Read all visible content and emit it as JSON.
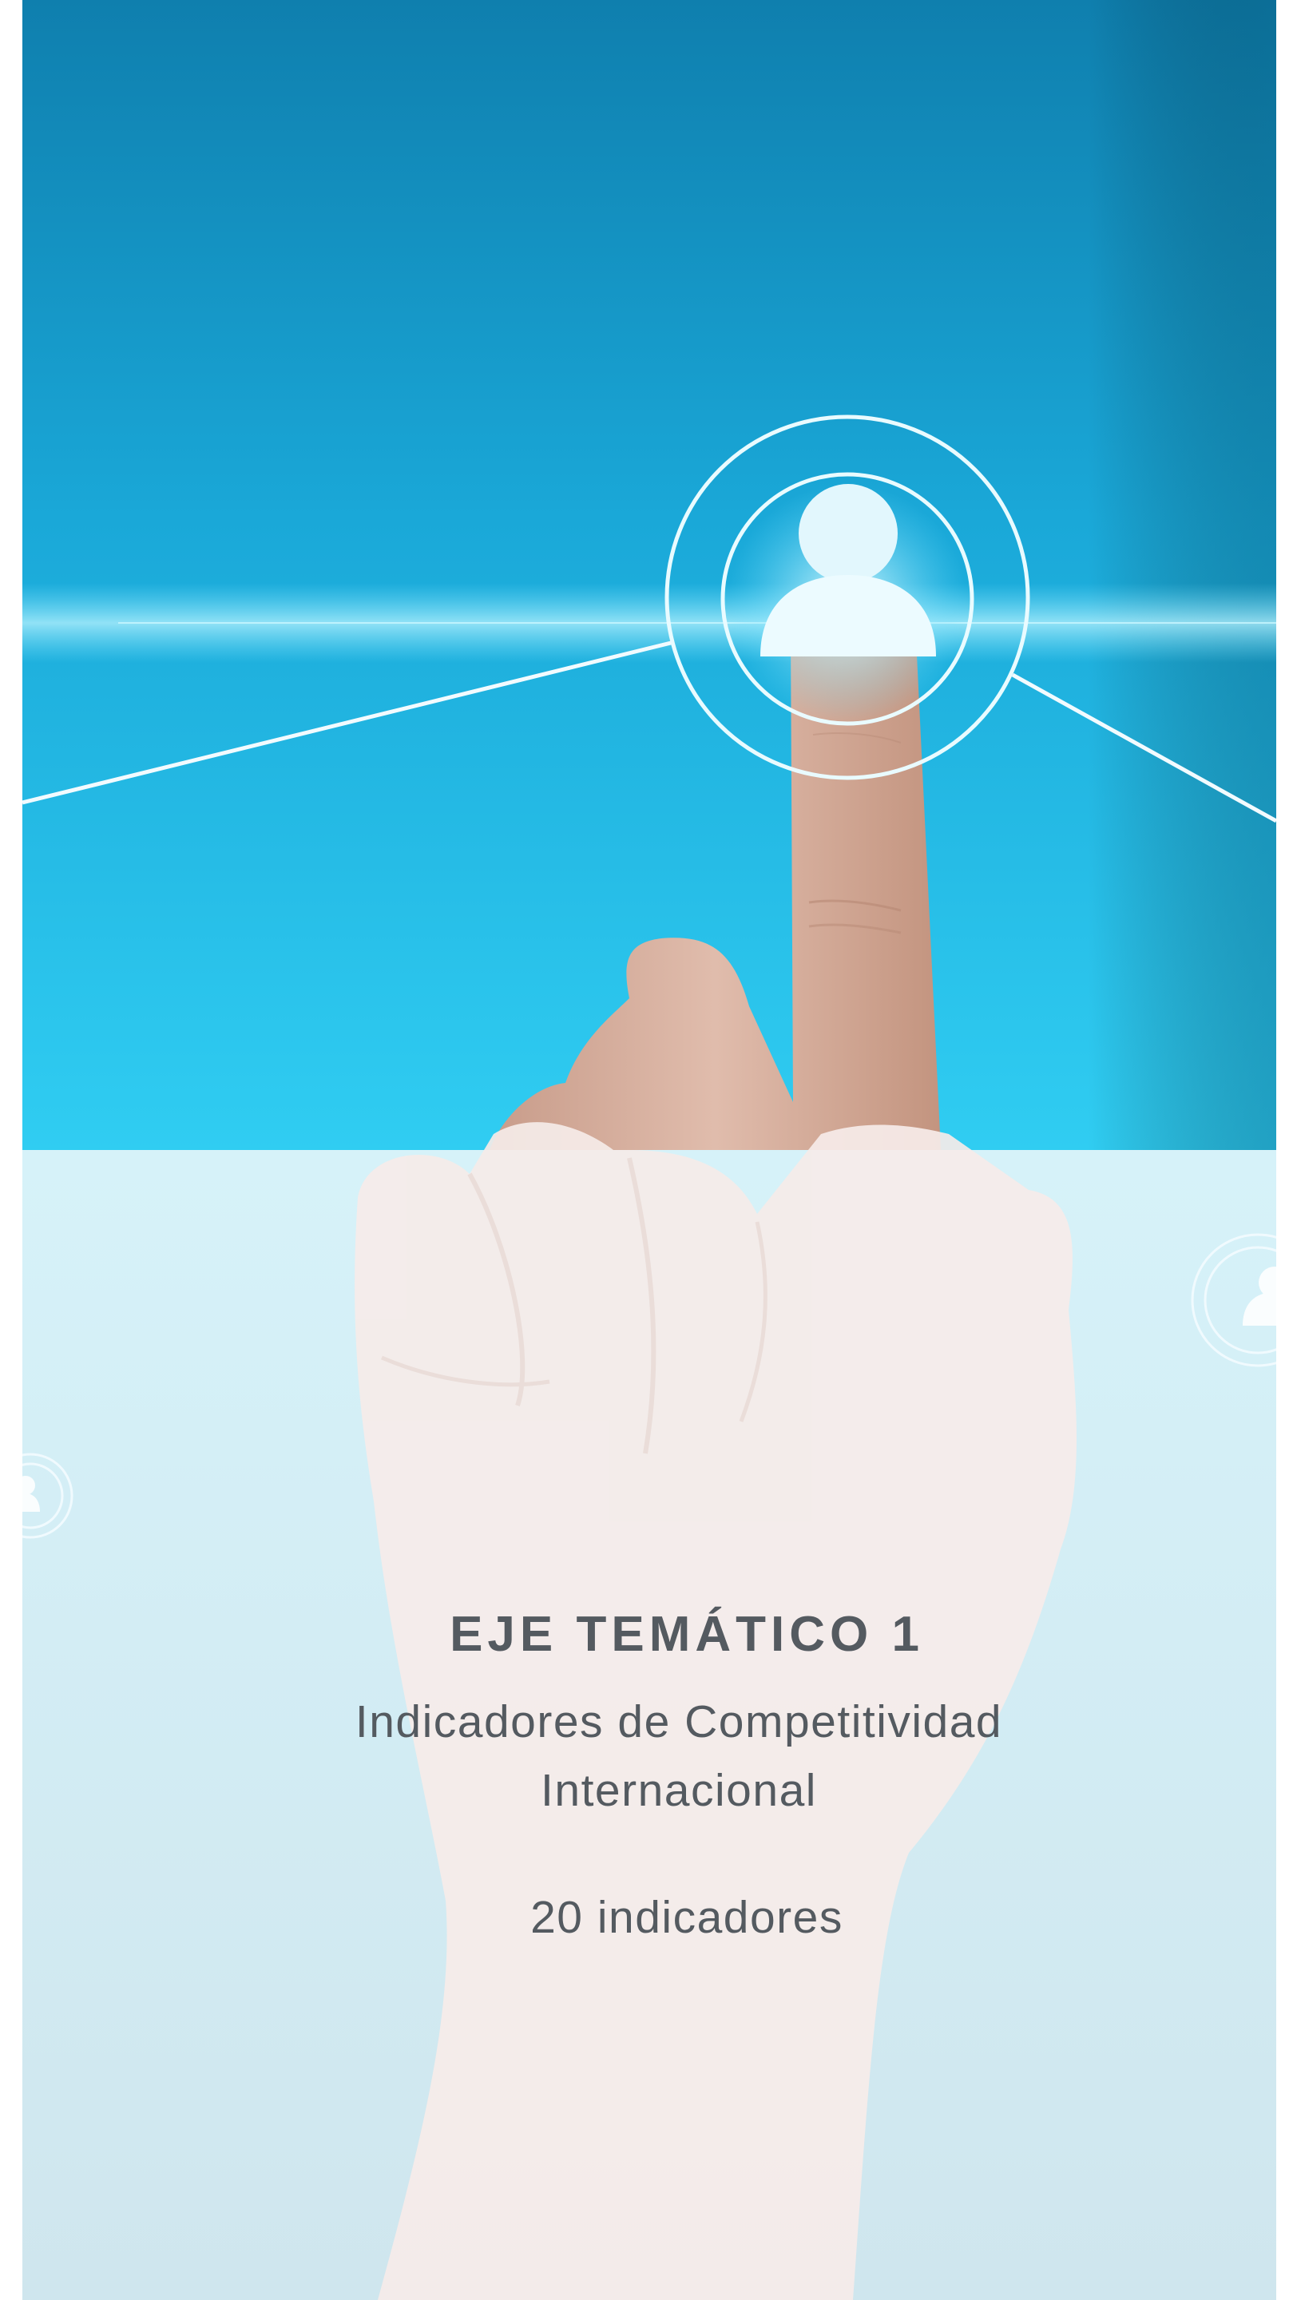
{
  "cover": {
    "title": "EJE TEMÁTICO 1",
    "subtitle_line1": "Indicadores de Competitividad",
    "subtitle_line2": "Internacional",
    "count": "20 indicadores"
  },
  "icons": {
    "main": "user-icon",
    "secondary": "user-icon"
  },
  "colors": {
    "sky_top": "#0f7fae",
    "sky_mid": "#2fc9ef",
    "lower_panel": "#d3eef6",
    "text": "#545a60"
  }
}
